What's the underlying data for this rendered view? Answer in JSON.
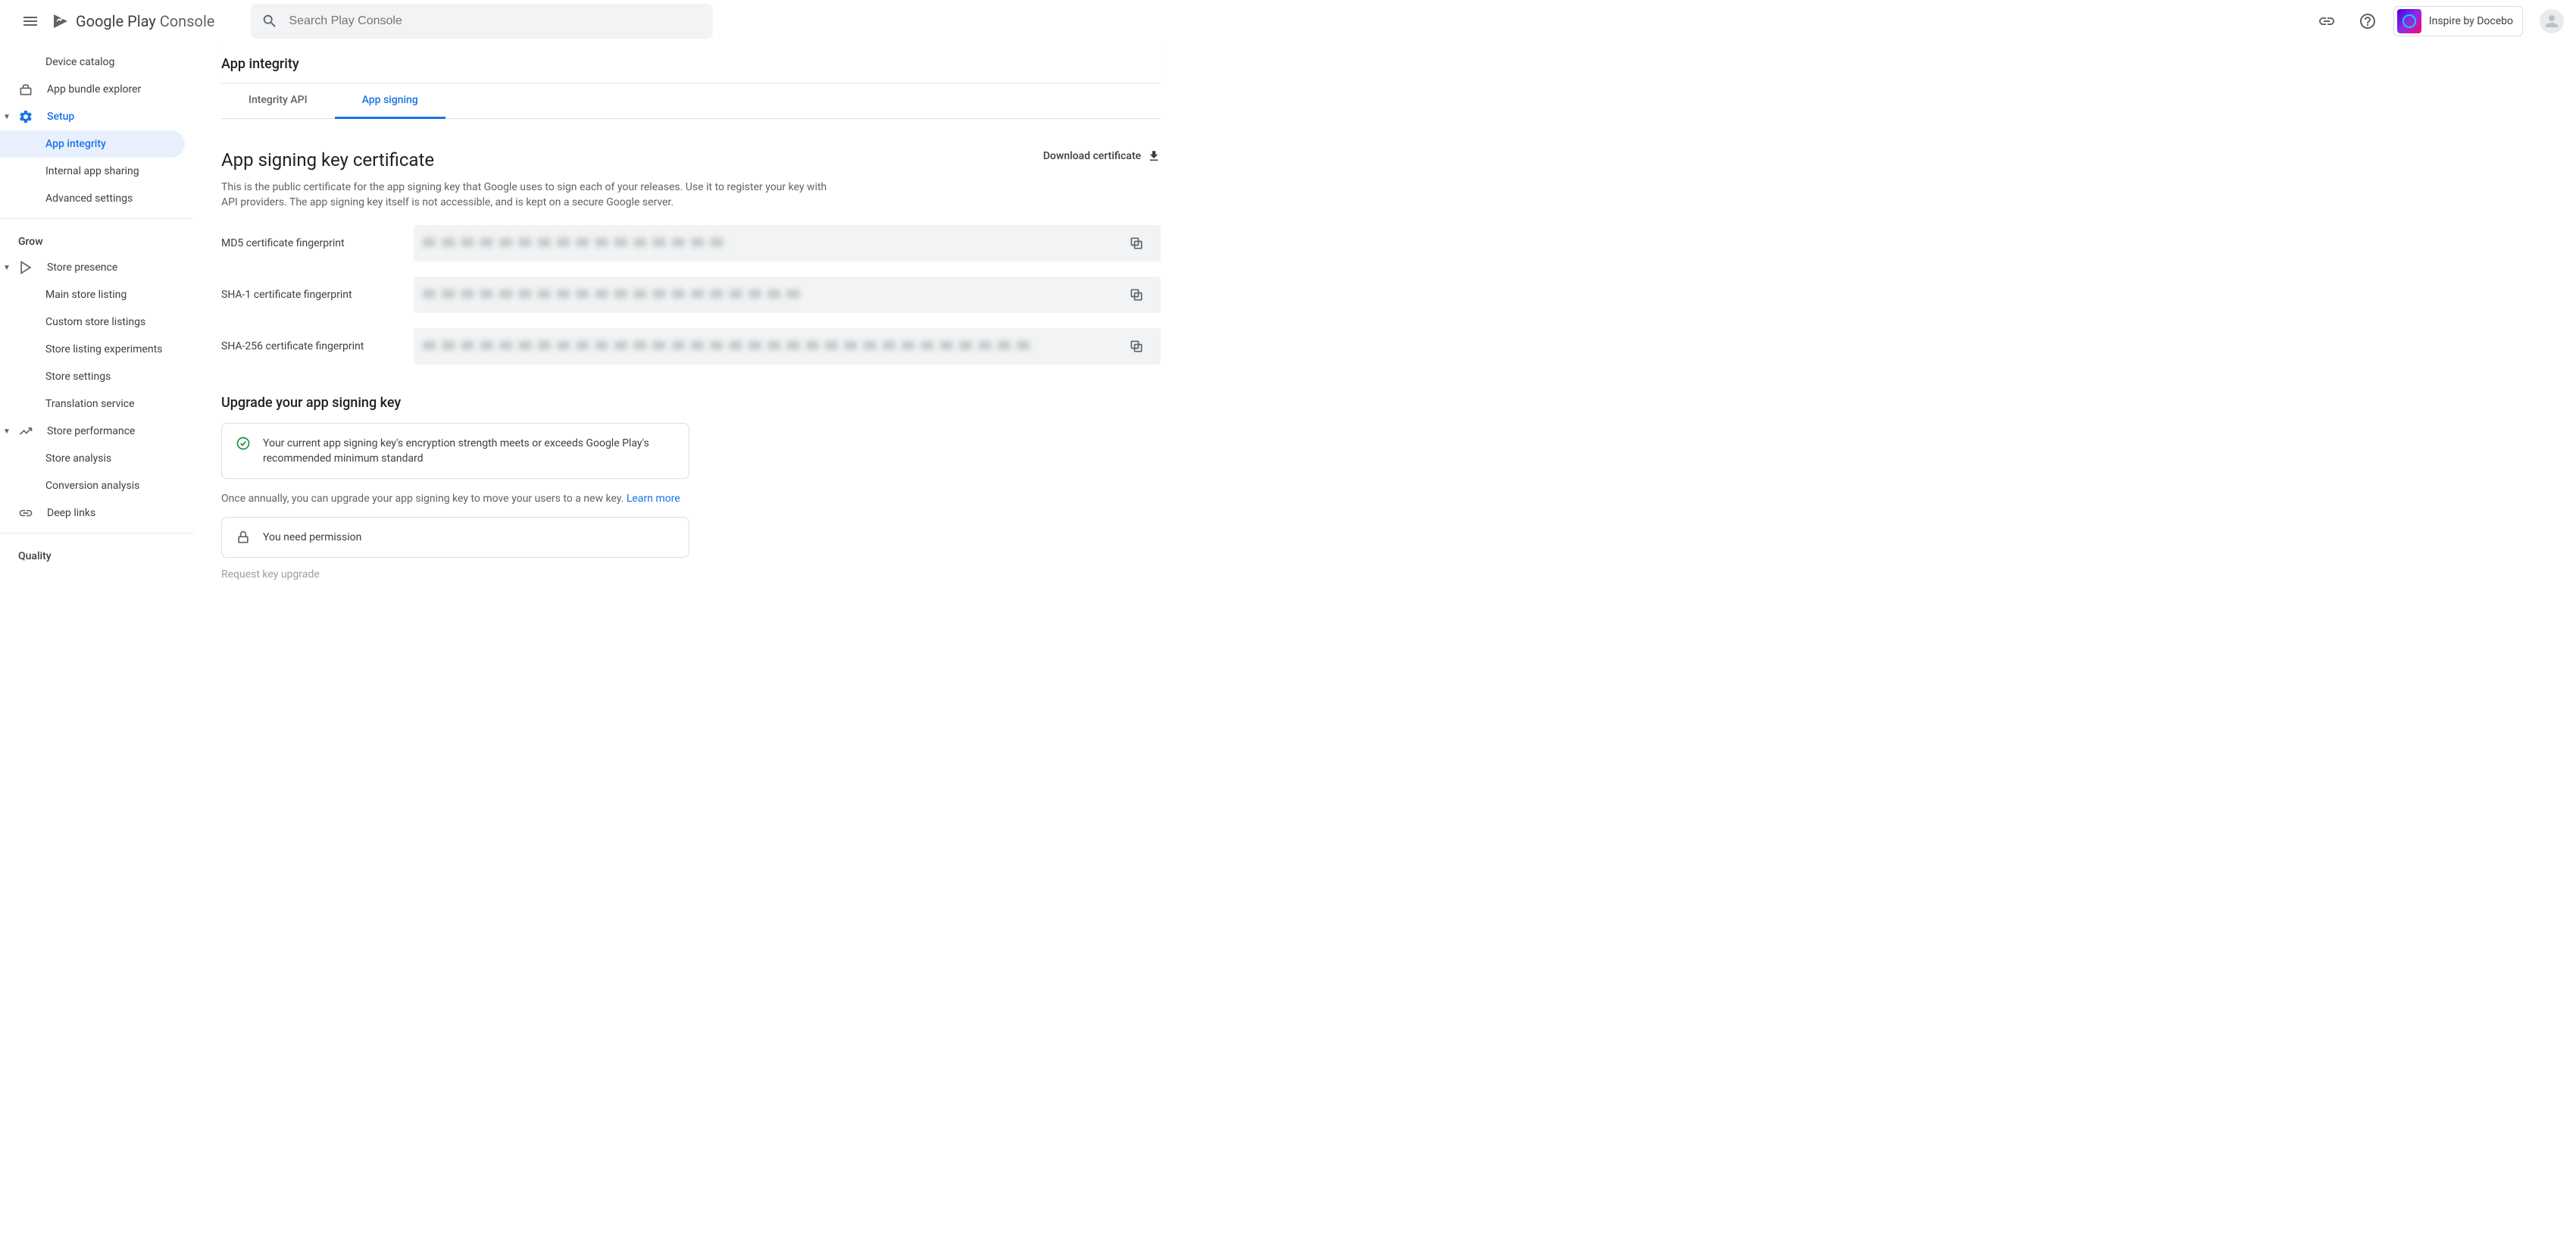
{
  "header": {
    "logo_text_1": "Google Play",
    "logo_text_2": "Console",
    "search_placeholder": "Search Play Console",
    "app_name": "Inspire by Docebo"
  },
  "sidebar": {
    "items": [
      {
        "label": "Device catalog"
      },
      {
        "label": "App bundle explorer"
      },
      {
        "label": "Setup"
      },
      {
        "label": "App integrity"
      },
      {
        "label": "Internal app sharing"
      },
      {
        "label": "Advanced settings"
      }
    ],
    "grow_label": "Grow",
    "store_presence": {
      "label": "Store presence",
      "children": [
        {
          "label": "Main store listing"
        },
        {
          "label": "Custom store listings"
        },
        {
          "label": "Store listing experiments"
        },
        {
          "label": "Store settings"
        },
        {
          "label": "Translation service"
        }
      ]
    },
    "store_performance": {
      "label": "Store performance",
      "children": [
        {
          "label": "Store analysis"
        },
        {
          "label": "Conversion analysis"
        }
      ]
    },
    "deep_links": {
      "label": "Deep links"
    },
    "quality_label": "Quality"
  },
  "page": {
    "title": "App integrity",
    "tabs": [
      {
        "label": "Integrity API"
      },
      {
        "label": "App signing"
      }
    ],
    "cert_section": {
      "title": "App signing key certificate",
      "download_label": "Download certificate",
      "desc": "This is the public certificate for the app signing key that Google uses to sign each of your releases. Use it to register your key with API providers. The app signing key itself is not accessible, and is kept on a secure Google server.",
      "rows": [
        {
          "label": "MD5 certificate fingerprint",
          "value": "XX XX XX XX XX XX XX XX XX XX XX XX XX XX XX XX"
        },
        {
          "label": "SHA-1 certificate fingerprint",
          "value": "XX XX XX XX XX XX XX XX XX XX XX XX XX XX XX XX XX XX XX XX"
        },
        {
          "label": "SHA-256 certificate fingerprint",
          "value": "XX XX XX XX XX XX XX XX XX XX XX XX XX XX XX XX XX XX XX XX XX XX XX XX XX XX XX XX XX XX XX XX"
        }
      ]
    },
    "upgrade_section": {
      "title": "Upgrade your app signing key",
      "status_text": "Your current app signing key's encryption strength meets or exceeds Google Play's recommended minimum standard",
      "annual_text": "Once annually, you can upgrade your app signing key to move your users to a new key. ",
      "learn_more": "Learn more",
      "permission_text": "You need permission",
      "request_label": "Request key upgrade"
    }
  }
}
